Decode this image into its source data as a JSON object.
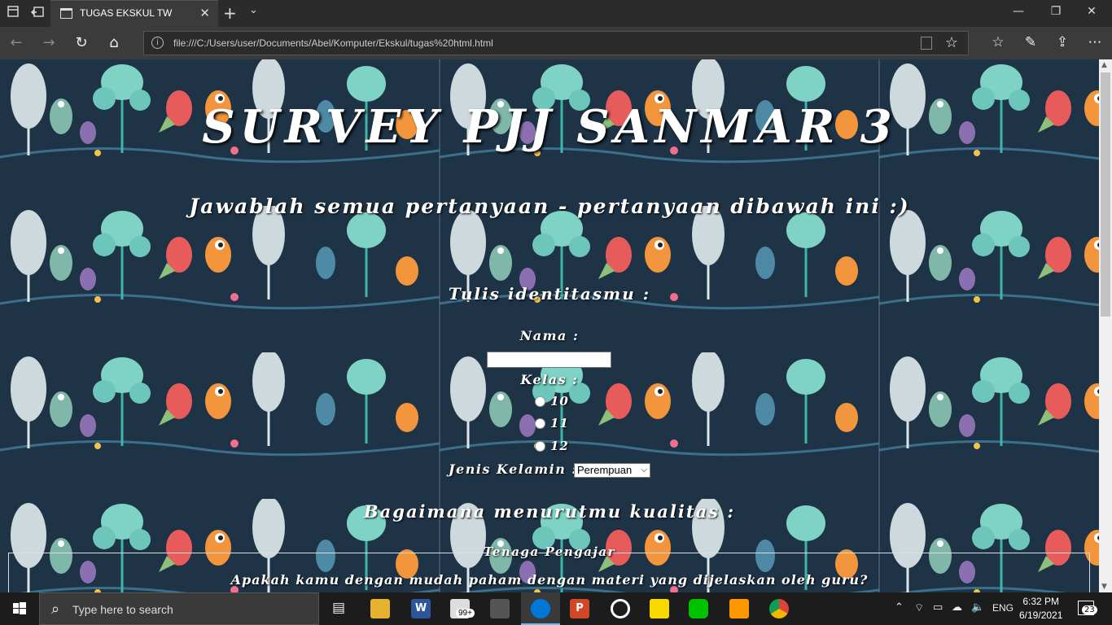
{
  "browser": {
    "tab_title": "TUGAS EKSKUL TW",
    "url": "file:///C:/Users/user/Documents/Abel/Komputer/Ekskul/tugas%20html.html"
  },
  "page": {
    "title": "SURVEY PJJ SANMAR 3",
    "subtitle": "Jawablah semua pertanyaan - pertanyaan dibawah ini :)",
    "identity_heading": "Tulis identitasmu :",
    "nama_label": "Nama :",
    "nama_value": "",
    "kelas_label": "Kelas :",
    "kelas_options": [
      "10",
      "11",
      "12"
    ],
    "gender_label": "Jenis Kelamin :",
    "gender_selected": "Perempuan",
    "quality_heading": "Bagaimana menurutmu kualitas :",
    "section_title": "Tenaga Pengajar",
    "question_1": "Apakah kamu dengan mudah paham dengan materi yang dijelaskan oleh guru?"
  },
  "taskbar": {
    "search_placeholder": "Type here to search",
    "mail_badge": "99+",
    "language": "ENG",
    "time": "6:32 PM",
    "date": "6/19/2021",
    "notification_count": "23"
  },
  "colors": {
    "page_bg": "#1e3346",
    "chrome_dark": "#2b2b2b",
    "chrome_mid": "#3b3b3b",
    "taskbar": "#1c1c1c",
    "edge_blue": "#0078d7"
  },
  "icons": [
    "tab-actions-icon",
    "back-tab-icon",
    "page-icon",
    "close-icon",
    "new-tab-icon",
    "chevron-down-icon",
    "minimize-icon",
    "maximize-icon",
    "window-close-icon",
    "back-icon",
    "forward-icon",
    "refresh-icon",
    "home-icon",
    "info-icon",
    "reading-view-icon",
    "favorite-star-icon",
    "favorites-icon",
    "pen-icon",
    "share-icon",
    "more-icon",
    "windows-logo-icon",
    "search-icon",
    "task-view-icon",
    "file-explorer-icon",
    "word-icon",
    "mail-icon",
    "store-icon",
    "edge-icon",
    "powerpoint-icon",
    "media-icon",
    "sticky-notes-icon",
    "line-icon",
    "sublime-icon",
    "chrome-icon",
    "chevron-up-icon",
    "wifi-icon",
    "battery-icon",
    "dropbox-icon",
    "volume-icon",
    "notification-icon"
  ]
}
